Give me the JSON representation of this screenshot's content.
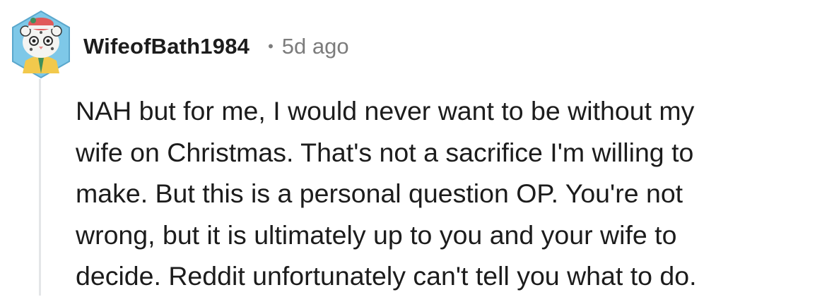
{
  "comment": {
    "author": "WifeofBath1984",
    "separator": "•",
    "age": "5d ago",
    "avatar_icon": "snow-leopard-avatar-icon",
    "body_lines": [
      "NAH but for me, I would never want to be without my",
      "wife on Christmas. That's not a sacrifice I'm willing to",
      "make. But this is a personal question OP. You're not",
      "wrong, but it is ultimately up to you and your wife to",
      "decide. Reddit unfortunately can't tell you what to do."
    ]
  },
  "colors": {
    "text": "#1c1c1c",
    "meta": "#7c7c7c",
    "avatar_bg": "#7ec8e8",
    "thread_line": "#e4e6e8"
  }
}
